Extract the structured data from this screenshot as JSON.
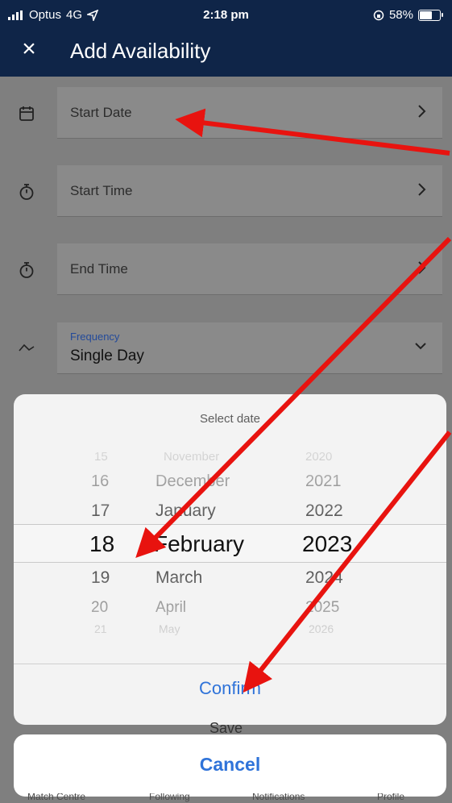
{
  "status_bar": {
    "carrier": "Optus",
    "network": "4G",
    "time": "2:18 pm",
    "battery": "58%"
  },
  "header": {
    "title": "Add Availability",
    "close_icon": "close-icon"
  },
  "form": {
    "start_date": {
      "label": "Start Date",
      "icon": "calendar-icon"
    },
    "start_time": {
      "label": "Start Time",
      "icon": "stopwatch-icon"
    },
    "end_time": {
      "label": "End Time",
      "icon": "stopwatch-icon"
    },
    "frequency": {
      "label": "Frequency",
      "value": "Single Day",
      "icon": "frequency-wave-icon"
    }
  },
  "date_picker": {
    "title": "Select date",
    "days": [
      "15",
      "16",
      "17",
      "18",
      "19",
      "20",
      "21"
    ],
    "months": [
      "November",
      "December",
      "January",
      "February",
      "March",
      "April",
      "May"
    ],
    "years": [
      "2020",
      "2021",
      "2022",
      "2023",
      "2024",
      "2025",
      "2026"
    ],
    "selected": {
      "day": "18",
      "month": "February",
      "year": "2023"
    },
    "confirm_label": "Confirm"
  },
  "save_label": "Save",
  "cancel_label": "Cancel",
  "tabs": [
    "Match Centre",
    "Following",
    "Notifications",
    "Profile"
  ],
  "colors": {
    "header_bg": "#0f2548",
    "accent": "#2f73d9",
    "arrow": "#e8130f"
  }
}
